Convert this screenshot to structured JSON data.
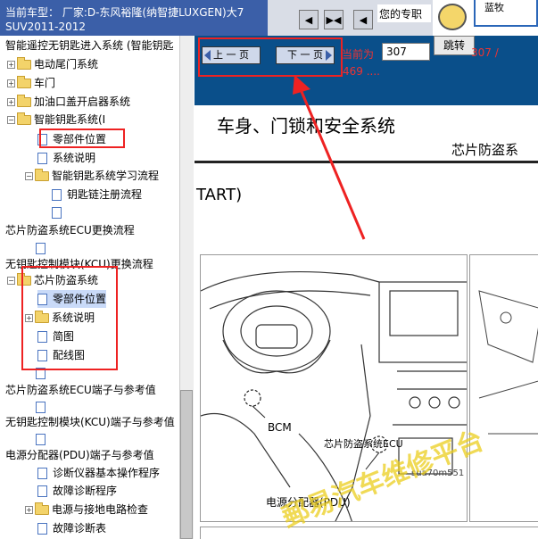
{
  "header": {
    "model_line1": "当前车型：  厂家:D-东风裕隆(纳智捷LUXGEN)大7",
    "model_line2": "SUV2011-2012",
    "nav_buttons": [
      "◀",
      "▶◀",
      "◀"
    ],
    "bookmark_label": "您的专职",
    "sign_text": "蓝牧"
  },
  "tree": {
    "items": [
      {
        "label": "智能遥控无钥匙进入系统 (智能钥匙"
      },
      {
        "label": "电动尾门系统"
      },
      {
        "label": "车门"
      },
      {
        "label": "加油口盖开启器系统"
      },
      {
        "label": "智能钥匙系统(I"
      },
      {
        "label": "零部件位置"
      },
      {
        "label": "系统说明"
      },
      {
        "label": "智能钥匙系统学习流程"
      },
      {
        "label": "钥匙链注册流程"
      },
      {
        "label": "芯片防盗系统ECU更换流程"
      },
      {
        "label": "无钥匙控制模块(KCU)更换流程"
      },
      {
        "label": "芯片防盗系统"
      },
      {
        "label": "零部件位置"
      },
      {
        "label": "系统说明"
      },
      {
        "label": "简图"
      },
      {
        "label": "配线图"
      },
      {
        "label": "芯片防盗系统ECU端子与参考值"
      },
      {
        "label": "无钥匙控制模块(KCU)端子与参考值"
      },
      {
        "label": "电源分配器(PDU)端子与参考值"
      },
      {
        "label": "诊断仪器基本操作程序"
      },
      {
        "label": "故障诊断程序"
      },
      {
        "label": "电源与接地电路检查"
      },
      {
        "label": "故障诊断表"
      }
    ]
  },
  "toolbar": {
    "prev_label": "上 一 页",
    "next_label": "下 一 页",
    "current_label": "当前为",
    "page_value": "307",
    "jump_label": "跳转",
    "total_a": "307 /",
    "total_b": "469 ...."
  },
  "document": {
    "title": "车身、门锁和安全系统",
    "subtitle": "芯片防盗系",
    "start_text": "TART)",
    "bcm_label": "BCM",
    "ecu_label": "芯片防盗系统ECU",
    "figure_id": "sua70m551",
    "pdu_label": "电源分配器(PDU)",
    "watermark": "郵易汽车维修平台"
  },
  "colors": {
    "highlight": "#e22222",
    "toolbar_bg": "#0a4f8a",
    "header_bg": "#3b5fa8"
  }
}
